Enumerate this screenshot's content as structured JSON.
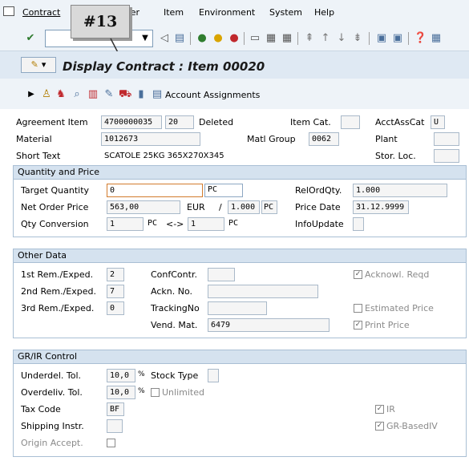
{
  "menu": {
    "items": [
      "Contract",
      "Header",
      "Item",
      "Environment",
      "System",
      "Help"
    ],
    "callout_label": "#13"
  },
  "title": {
    "text": "Display Contract : Item 00020"
  },
  "appbar": {
    "account_assignments_label": "Account Assignments"
  },
  "header": {
    "agreement_item_label": "Agreement Item",
    "agreement_value": "4700000035",
    "item_value": "20",
    "deleted_label": "Deleted",
    "item_cat_label": "Item Cat.",
    "acctasscat_label": "AcctAssCat",
    "acctasscat_value": "U",
    "material_label": "Material",
    "material_value": "1012673",
    "matl_group_label": "Matl Group",
    "matl_group_value": "0062",
    "plant_label": "Plant",
    "short_text_label": "Short Text",
    "short_text_value": "SCATOLE 25KG 365X270X345",
    "stor_loc_label": "Stor. Loc."
  },
  "quantity_price": {
    "section_title": "Quantity and Price",
    "target_qty_label": "Target Quantity",
    "target_qty_value": "0",
    "target_qty_unit": "PC",
    "relordqty_label": "RelOrdQty.",
    "relordqty_value": "1.000",
    "net_price_label": "Net Order Price",
    "net_price_value": "563,00",
    "currency": "EUR",
    "per_label": "/",
    "per_value": "1.000",
    "per_unit": "PC",
    "price_date_label": "Price Date",
    "price_date_value": "31.12.9999",
    "qty_conv_label": "Qty Conversion",
    "qty_conv_from": "1",
    "qty_conv_from_unit": "PC",
    "qty_conv_arrow": "<->",
    "qty_conv_to": "1",
    "qty_conv_to_unit": "PC",
    "infoupdate_label": "InfoUpdate"
  },
  "other_data": {
    "section_title": "Other Data",
    "rem1_label": "1st Rem./Exped.",
    "rem1_value": "2",
    "rem2_label": "2nd Rem./Exped.",
    "rem2_value": "7",
    "rem3_label": "3rd Rem./Exped.",
    "rem3_value": "0",
    "confcontr_label": "ConfContr.",
    "ackn_no_label": "Ackn. No.",
    "trackingno_label": "TrackingNo",
    "vend_mat_label": "Vend. Mat.",
    "vend_mat_value": "6479",
    "acknowl_reqd_label": "Acknowl. Reqd",
    "estimated_price_label": "Estimated Price",
    "print_price_label": "Print Price"
  },
  "grir": {
    "section_title": "GR/IR Control",
    "underdel_label": "Underdel. Tol.",
    "underdel_value": "10,0",
    "pct": "%",
    "overdeliv_label": "Overdeliv. Tol.",
    "overdeliv_value": "10,0",
    "stock_type_label": "Stock Type",
    "unlimited_label": "Unlimited",
    "tax_code_label": "Tax Code",
    "tax_code_value": "BF",
    "shipping_label": "Shipping Instr.",
    "origin_label": "Origin Accept.",
    "ir_label": "IR",
    "gr_basediv_label": "GR-BasedIV"
  }
}
